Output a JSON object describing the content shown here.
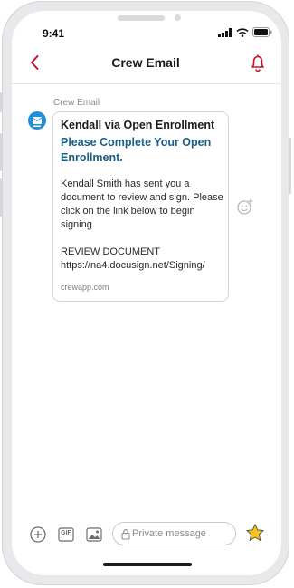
{
  "status": {
    "time": "9:41"
  },
  "nav": {
    "title": "Crew Email"
  },
  "message": {
    "sender": "Crew Email",
    "from_line": "Kendall via Open Enrollment",
    "subject": "Please Complete Your Open Enrollment.",
    "body": "Kendall Smith has sent you a document to review and sign. Please click on the link below to begin signing.",
    "link_label": "REVIEW DOCUMENT",
    "link_url": "https://na4.docusign.net/Signing/",
    "domain": "crewapp.com"
  },
  "composer": {
    "placeholder": "Private message",
    "gif_label": "GIF"
  },
  "colors": {
    "accent": "#c8102e",
    "subject": "#1a5f88",
    "avatar": "#1e8fd8",
    "star": "#f5c518"
  }
}
